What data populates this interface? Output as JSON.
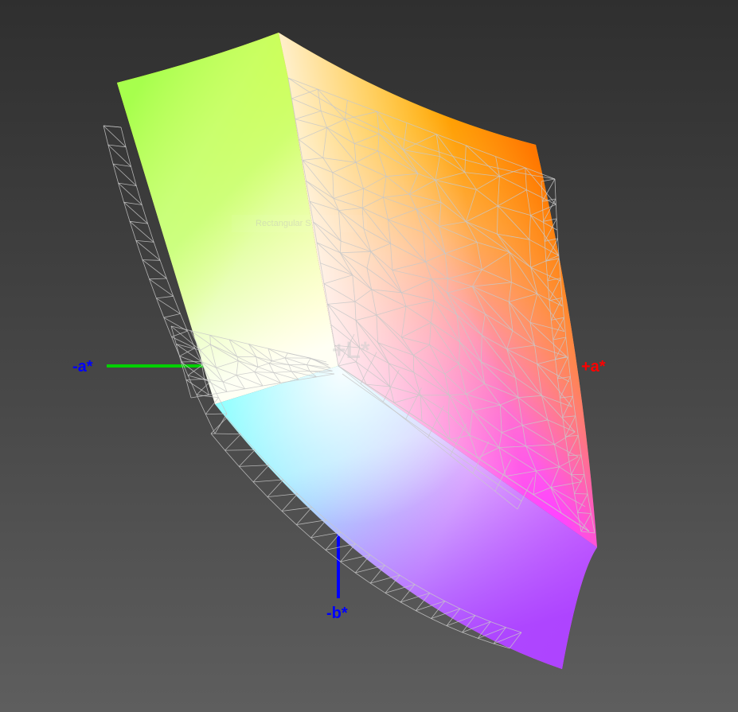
{
  "diagram": {
    "axes": {
      "neg_a": {
        "label": "-a*",
        "color": "#0000ff",
        "line_color": "#00d000"
      },
      "pos_a": {
        "label": "+a*",
        "color": "#ff0000",
        "line_color": "#ff0000"
      },
      "neg_b": {
        "label": "-b*",
        "color": "#0000ff",
        "line_color": "#0000ff"
      },
      "pos_l": {
        "label": "+L*",
        "color": "#cfcfcf"
      }
    },
    "overlay_tag": "Rectangular S",
    "colors": {
      "yellow": "#ffff00",
      "orange": "#ff7700",
      "green": "#99ff00",
      "cyan": "#80ffff",
      "magenta": "#ff44ff",
      "violet": "#aa44ff",
      "white": "#ffffff",
      "wireframe": "#c8c8c8"
    }
  }
}
